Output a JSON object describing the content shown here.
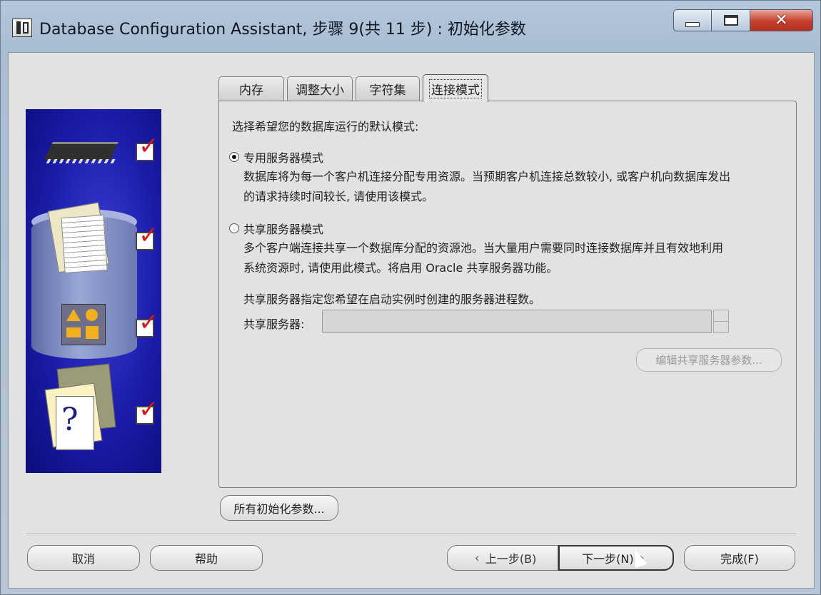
{
  "window": {
    "title": "Database Configuration Assistant, 步骤 9(共 11 步) : 初始化参数"
  },
  "tabs": [
    {
      "label": "内存"
    },
    {
      "label": "调整大小"
    },
    {
      "label": "字符集"
    },
    {
      "label": "连接模式"
    }
  ],
  "active_tab": "连接模式",
  "panel": {
    "prompt": "选择希望您的数据库运行的默认模式:",
    "dedicated": {
      "label": "专用服务器模式",
      "selected": true,
      "desc_line1": "数据库将为每一个客户机连接分配专用资源。当预期客户机连接总数较小, 或客户机向数据库发出",
      "desc_line2": "的请求持续时间较长, 请使用该模式。"
    },
    "shared": {
      "label": "共享服务器模式",
      "selected": false,
      "desc_line1": "多个客户端连接共享一个数据库分配的资源池。当大量用户需要同时连接数据库并且有效地利用",
      "desc_line2": "系统资源时, 请使用此模式。将启用 Oracle 共享服务器功能。"
    },
    "shared_servers_note": "共享服务器指定您希望在启动实例时创建的服务器进程数。",
    "shared_servers_label": "共享服务器:",
    "shared_servers_value": "",
    "edit_shared_button": "编辑共享服务器参数..."
  },
  "all_params_button": "所有初始化参数...",
  "footer": {
    "cancel": "取消",
    "help": "帮助",
    "back": "上一步(B)",
    "next": "下一步(N)",
    "finish": "完成(F)"
  },
  "colors": {
    "side_panel": "#1b1ba8",
    "check_mark": "#d21a1a",
    "close_button": "#c4402d"
  },
  "icons": [
    "chip-icon",
    "documents-icon",
    "shapes-icon",
    "help-documents-icon",
    "checkbox-checked-icon"
  ]
}
